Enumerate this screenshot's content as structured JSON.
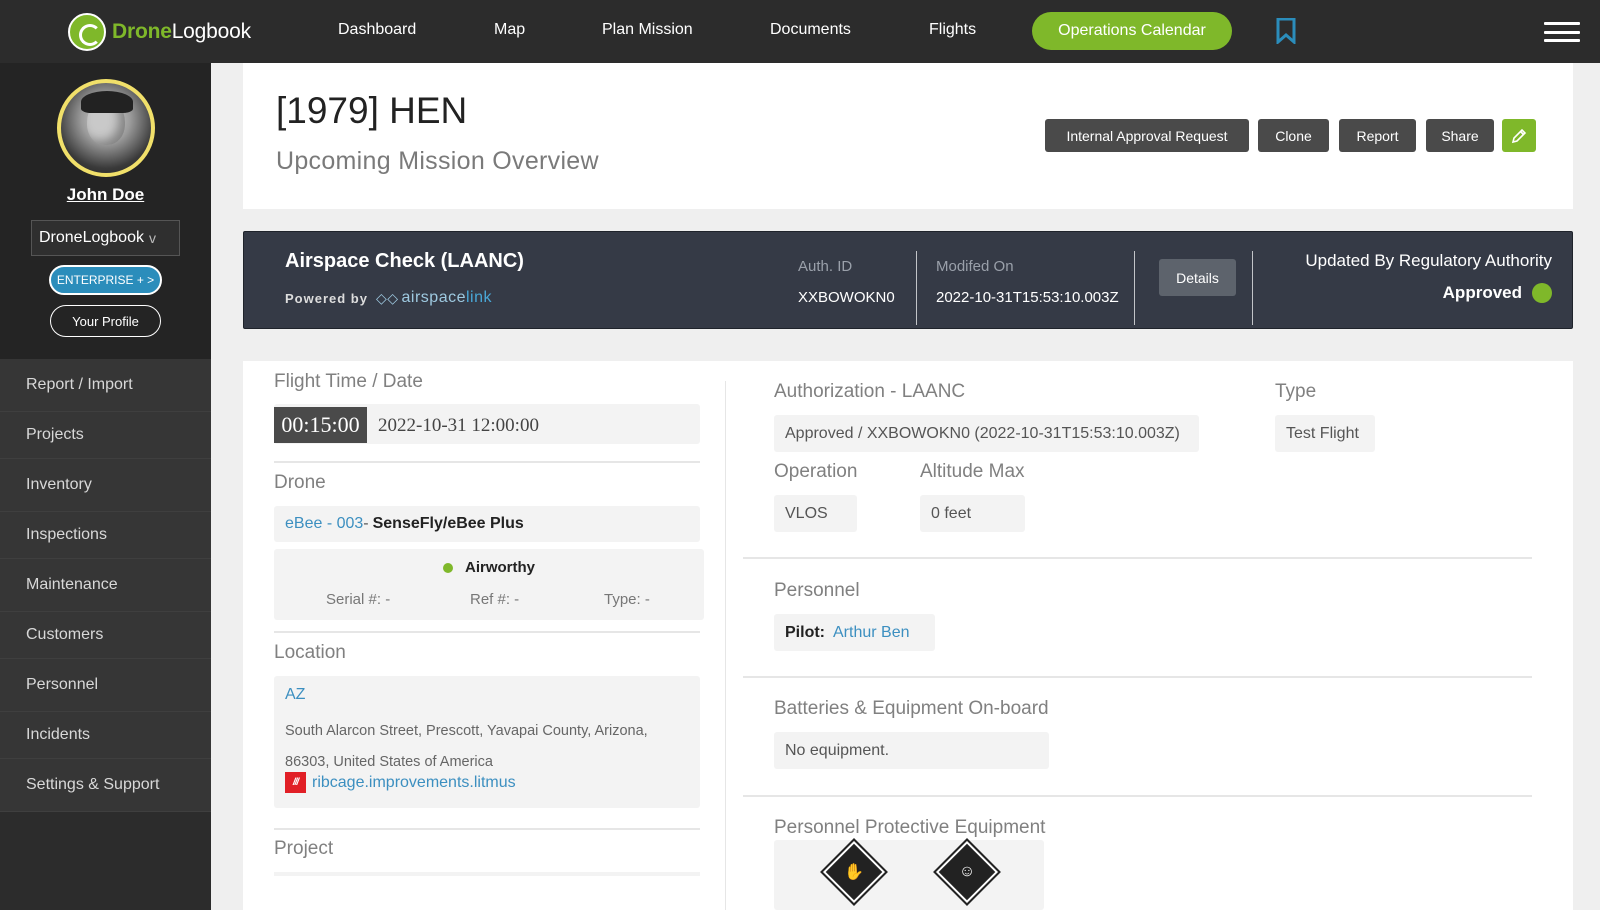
{
  "nav": {
    "logo_brand": "Drone",
    "logo_suffix": "Logbook",
    "items": [
      "Dashboard",
      "Map",
      "Plan Mission",
      "Documents",
      "Flights"
    ],
    "calendar_label": "Operations Calendar",
    "bookmark_icon": "bookmark-icon",
    "menu_icon": "hamburger-icon"
  },
  "sidebar": {
    "user_name": "John Doe",
    "org_label": "DroneLogbook",
    "org_chevron": "v",
    "plan_badge": "ENTERPRISE + >",
    "profile_button": "Your Profile",
    "menu": [
      "Report / Import",
      "Projects",
      "Inventory",
      "Inspections",
      "Maintenance",
      "Customers",
      "Personnel",
      "Incidents",
      "Settings & Support"
    ]
  },
  "header": {
    "title": "[1979] HEN",
    "subtitle": "Upcoming Mission Overview",
    "buttons": [
      "Internal Approval Request",
      "Clone",
      "Report",
      "Share"
    ],
    "edit_icon": "pencil-icon"
  },
  "airspace": {
    "title": "Airspace Check (LAANC)",
    "powered_by": "Powered by",
    "provider_a": "airspace",
    "provider_b": "link",
    "auth_id_label": "Auth. ID",
    "auth_id": "XXBOWOKN0",
    "modified_label": "Modifed On",
    "modified": "2022-10-31T15:53:10.003Z",
    "details_button": "Details",
    "updated_by": "Updated By Regulatory Authority",
    "status": "Approved",
    "status_color": "#7fb82a"
  },
  "mission": {
    "flight_time_label": "Flight Time / Date",
    "duration": "00:15:00",
    "datetime": "2022-10-31 12:00:00",
    "drone_label": "Drone",
    "drone_id": "eBee - 003",
    "drone_sep": " -",
    "drone_model": "SenseFly/eBee Plus",
    "airworthy": "Airworthy",
    "serial": "Serial #: -",
    "ref": "Ref #: -",
    "type_meta": "Type: -",
    "location_label": "Location",
    "location_code": "AZ",
    "address": "South Alarcon Street, Prescott, Yavapai County, Arizona, 86303, United States of America",
    "w3w_icon": "///",
    "w3w": "ribcage.improvements.litmus",
    "project_label": "Project",
    "authorization_label": "Authorization - LAANC",
    "authorization": "Approved / XXBOWOKN0 (2022-10-31T15:53:10.003Z)",
    "type_label": "Type",
    "type": "Test Flight",
    "operation_label": "Operation",
    "operation": "VLOS",
    "altitude_label": "Altitude Max",
    "altitude": "0 feet",
    "personnel_label": "Personnel",
    "pilot_label": "Pilot:",
    "pilot": "Arthur Ben",
    "batteries_label": "Batteries & Equipment On-board",
    "batteries": "No equipment.",
    "ppe_label": "Personnel Protective Equipment",
    "ppe_icons": [
      "gloves-icon",
      "face-mask-icon"
    ]
  }
}
